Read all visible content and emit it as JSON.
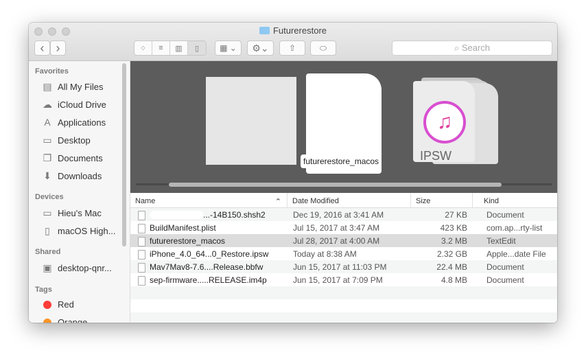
{
  "window": {
    "title": "Futurerestore"
  },
  "toolbar": {
    "search_placeholder": "Search",
    "back": "‹",
    "forward": "›"
  },
  "sidebar": {
    "favorites_label": "Favorites",
    "favorites": [
      {
        "label": "All My Files",
        "icon": "▤"
      },
      {
        "label": "iCloud Drive",
        "icon": "☁"
      },
      {
        "label": "Applications",
        "icon": "A"
      },
      {
        "label": "Desktop",
        "icon": "▭"
      },
      {
        "label": "Documents",
        "icon": "❐"
      },
      {
        "label": "Downloads",
        "icon": "⬇"
      }
    ],
    "devices_label": "Devices",
    "devices": [
      {
        "label": "Hieu's Mac",
        "icon": "▭"
      },
      {
        "label": "macOS High...",
        "icon": "▯"
      }
    ],
    "shared_label": "Shared",
    "shared": [
      {
        "label": "desktop-qnr...",
        "icon": "▣"
      }
    ],
    "tags_label": "Tags",
    "tags": [
      {
        "label": "Red",
        "color": "#fc3d39"
      },
      {
        "label": "Orange",
        "color": "#fd9426"
      }
    ]
  },
  "coverflow": {
    "selected_label": "futurerestore_macos",
    "ipsw_label": "IPSW"
  },
  "table": {
    "headers": {
      "name": "Name",
      "date": "Date Modified",
      "size": "Size",
      "kind": "Kind"
    },
    "rows": [
      {
        "name": "...-14B150.shsh2",
        "date": "Dec 19, 2016 at 3:41 AM",
        "size": "27 KB",
        "kind": "Document"
      },
      {
        "name": "BuildManifest.plist",
        "date": "Jul 15, 2017 at 3:47 AM",
        "size": "423 KB",
        "kind": "com.ap...rty-list"
      },
      {
        "name": "futurerestore_macos",
        "date": "Jul 28, 2017 at 4:00 AM",
        "size": "3.2 MB",
        "kind": "TextEdit"
      },
      {
        "name": "iPhone_4.0_64...0_Restore.ipsw",
        "date": "Today at 8:38 AM",
        "size": "2.32 GB",
        "kind": "Apple...date File"
      },
      {
        "name": "Mav7Mav8-7.6....Release.bbfw",
        "date": "Jun 15, 2017 at 11:03 PM",
        "size": "22.4 MB",
        "kind": "Document"
      },
      {
        "name": "sep-firmware.....RELEASE.im4p",
        "date": "Jun 15, 2017 at 7:09 PM",
        "size": "4.8 MB",
        "kind": "Document"
      }
    ]
  }
}
